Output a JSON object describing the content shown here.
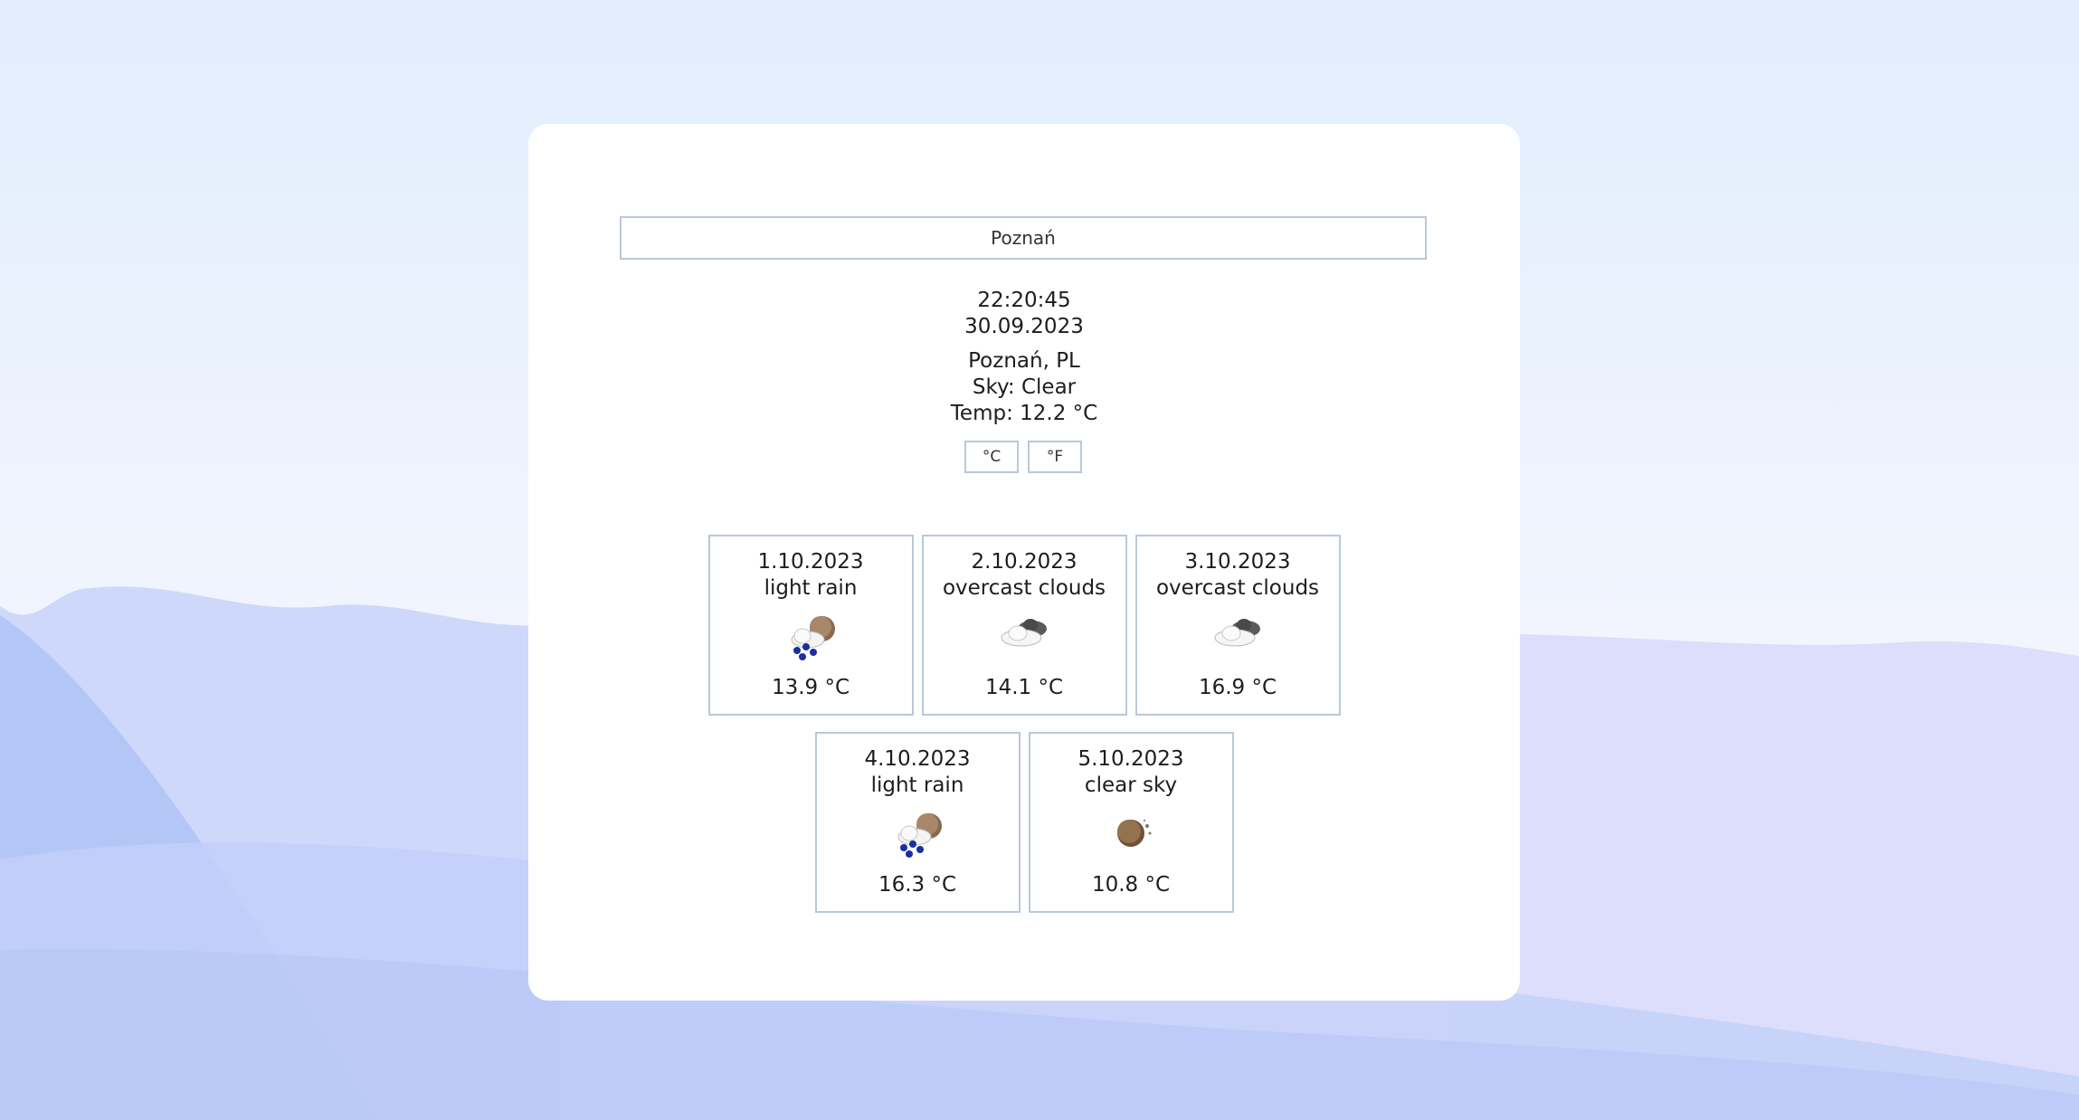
{
  "search": {
    "value": "Poznań"
  },
  "clock": {
    "time": "22:20:45",
    "date": "30.09.2023"
  },
  "current": {
    "location": "Poznań, PL",
    "sky": "Sky: Clear",
    "temp": "Temp: 12.2 °C"
  },
  "units": {
    "celsius": "°C",
    "fahrenheit": "°F"
  },
  "forecast": [
    {
      "date": "1.10.2023",
      "desc": "light rain",
      "icon": "light-rain-night-icon",
      "temp": "13.9 °C"
    },
    {
      "date": "2.10.2023",
      "desc": "overcast clouds",
      "icon": "overcast-clouds-icon",
      "temp": "14.1 °C"
    },
    {
      "date": "3.10.2023",
      "desc": "overcast clouds",
      "icon": "overcast-clouds-icon",
      "temp": "16.9 °C"
    },
    {
      "date": "4.10.2023",
      "desc": "light rain",
      "icon": "light-rain-night-icon",
      "temp": "16.3 °C"
    },
    {
      "date": "5.10.2023",
      "desc": "clear sky",
      "icon": "clear-sky-night-icon",
      "temp": "10.8 °C"
    }
  ]
}
